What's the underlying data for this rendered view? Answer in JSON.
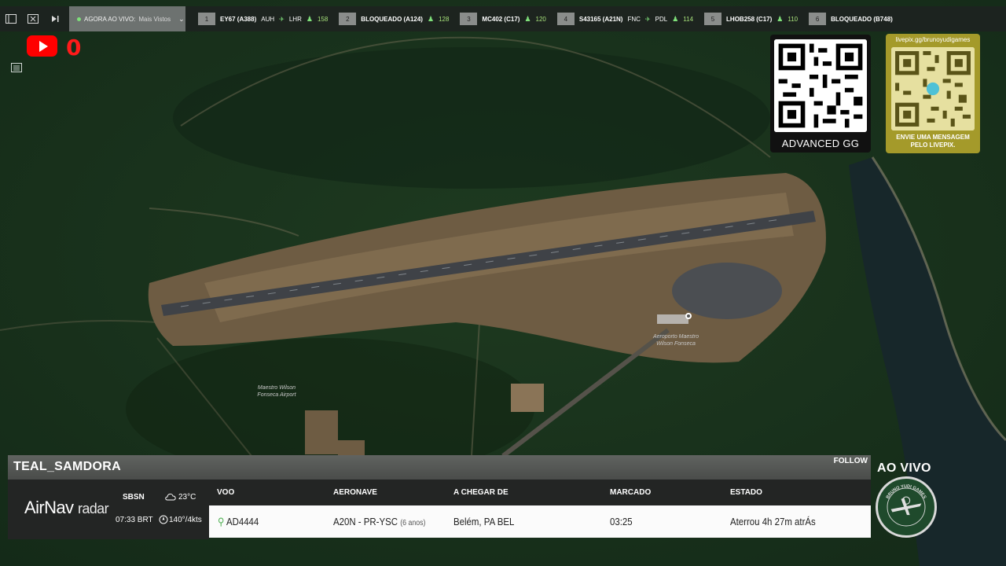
{
  "topbar": {
    "tab_label": "AGORA AO VIVO:",
    "tab_sub": "Mais Vistos",
    "flights": [
      {
        "num": "1",
        "callsign": "EY67 (A388)",
        "route_from": "AUH",
        "route_to": "LHR",
        "count": "158"
      },
      {
        "num": "2",
        "callsign": "BLOQUEADO (A124)",
        "route_from": "",
        "route_to": "",
        "count": "128"
      },
      {
        "num": "3",
        "callsign": "MC402 (C17)",
        "route_from": "",
        "route_to": "",
        "count": "120"
      },
      {
        "num": "4",
        "callsign": "S43165 (A21N)",
        "route_from": "FNC",
        "route_to": "PDL",
        "count": "114"
      },
      {
        "num": "5",
        "callsign": "LHOB258 (C17)",
        "route_from": "",
        "route_to": "",
        "count": "110"
      },
      {
        "num": "6",
        "callsign": "BLOQUEADO (B748)",
        "route_from": "",
        "route_to": "",
        "count": ""
      }
    ]
  },
  "viewer_count": "0",
  "qr_advanced": {
    "label": "ADVANCED GG"
  },
  "qr_livepix": {
    "url": "livepix.gg/brunoyudigames",
    "label_line1": "ENVIE UMA MENSAGEM",
    "label_line2": "PELO LIVEPIX."
  },
  "map": {
    "airport_label_line1": "Maestro Wilson",
    "airport_label_line2": "Fonseca Airport",
    "marker_label_line1": "Aeroporto Maestro",
    "marker_label_line2": "Wilson Fonseca"
  },
  "panel": {
    "username": "TEAL_SAMDORA",
    "follow": "FOLLOW",
    "brand": "AirNav",
    "brand_sub": "radar",
    "airport_code": "SBSN",
    "local_time": "07:33 BRT",
    "temperature": "23°C",
    "wind": "140°/4kts",
    "columns": [
      "VOO",
      "AERONAVE",
      "A CHEGAR DE",
      "MARCADO",
      "ESTADO"
    ],
    "row": {
      "flight": "AD4444",
      "aircraft": "A20N - PR-YSC",
      "aircraft_age": "(6 anos)",
      "origin": "Belém, PA BEL",
      "scheduled": "03:25",
      "status": "Aterrou 4h 27m atrÁs"
    }
  },
  "live_label": "AO VIVO",
  "badge_text": "BRUNO YUDI GAMES"
}
